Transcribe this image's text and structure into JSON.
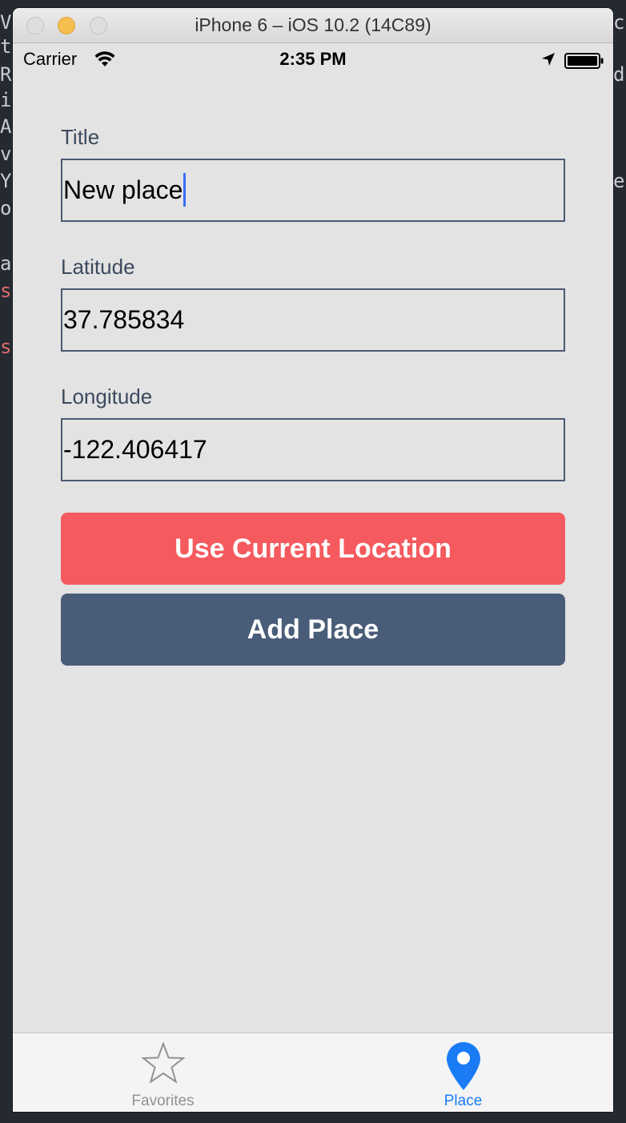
{
  "window": {
    "title": "iPhone 6 – iOS 10.2 (14C89)"
  },
  "status_bar": {
    "carrier": "Carrier",
    "time": "2:35 PM",
    "icons": [
      "wifi-icon",
      "location-arrow-icon",
      "battery-icon"
    ]
  },
  "form": {
    "title_label": "Title",
    "title_value": "New place",
    "latitude_label": "Latitude",
    "latitude_value": "37.785834",
    "longitude_label": "Longitude",
    "longitude_value": "-122.406417"
  },
  "buttons": {
    "use_location": "Use Current Location",
    "add_place": "Add Place"
  },
  "tab_bar": {
    "tabs": [
      {
        "label": "Favorites",
        "icon": "star-icon",
        "selected": false
      },
      {
        "label": "Place",
        "icon": "map-pin-icon",
        "selected": true
      }
    ]
  },
  "colors": {
    "accent_red": "#f55a5e",
    "button_slate": "#495d79",
    "tab_selected": "#1a7cf5",
    "background": "#e3e3e3"
  }
}
